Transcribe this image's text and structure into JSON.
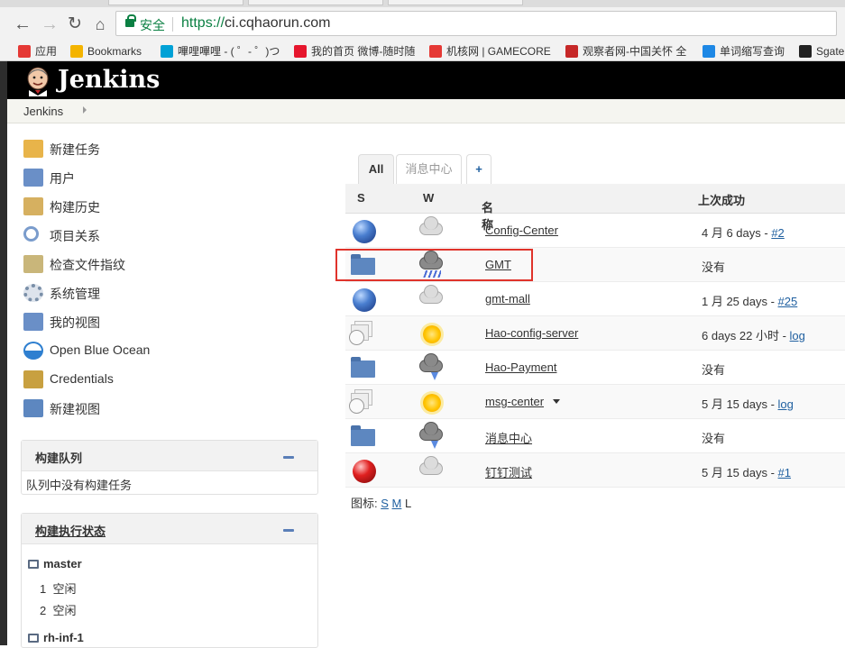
{
  "browser": {
    "secure_label": "安全",
    "url_proto": "https://",
    "url_host": "ci.cqhaorun.com"
  },
  "bookmarks": [
    {
      "label": "应用",
      "icon": "apps-grid-icon",
      "color": "#e53935"
    },
    {
      "label": "Bookmarks",
      "icon": "star-icon",
      "color": "#f4b400"
    },
    {
      "label": "嗶哩嗶哩 - ( ゜- ゜)つ",
      "icon": "bilibili-icon",
      "color": "#00a1d6"
    },
    {
      "label": "我的首页 微博-随时随",
      "icon": "weibo-icon",
      "color": "#e6162d"
    },
    {
      "label": "机核网 | GAMECORE",
      "icon": "gcores-icon",
      "color": "#e53935"
    },
    {
      "label": "观察者网-中国关怀 全",
      "icon": "guancha-icon",
      "color": "#c62828"
    },
    {
      "label": "单词缩写查询",
      "icon": "abbr-a-icon",
      "color": "#1e88e5"
    },
    {
      "label": "Sgate",
      "icon": "github-icon",
      "color": "#222222"
    }
  ],
  "header": {
    "title": "Jenkins"
  },
  "breadcrumb": {
    "root": "Jenkins"
  },
  "sidebar": {
    "tasks": [
      {
        "label": "新建任务",
        "icon": "new-item-icon"
      },
      {
        "label": "用户",
        "icon": "people-icon"
      },
      {
        "label": "构建历史",
        "icon": "build-history-icon"
      },
      {
        "label": "项目关系",
        "icon": "search-icon"
      },
      {
        "label": "检查文件指纹",
        "icon": "fingerprint-icon"
      },
      {
        "label": "系统管理",
        "icon": "gear-icon"
      },
      {
        "label": "我的视图",
        "icon": "people-icon"
      },
      {
        "label": "Open Blue Ocean",
        "icon": "blue-ocean-icon"
      },
      {
        "label": "Credentials",
        "icon": "credentials-icon"
      },
      {
        "label": "新建视图",
        "icon": "folder-icon"
      }
    ]
  },
  "queue": {
    "title": "构建队列",
    "empty_text": "队列中没有构建任务"
  },
  "executors": {
    "title": "构建执行状态",
    "nodes": [
      {
        "name": "master",
        "slots": [
          {
            "num": "1",
            "status": "空闲"
          },
          {
            "num": "2",
            "status": "空闲"
          }
        ]
      },
      {
        "name": "rh-inf-1"
      }
    ]
  },
  "view_tabs": [
    {
      "label": "All",
      "active": true
    },
    {
      "label": "消息中心",
      "active": false
    },
    {
      "label": "+",
      "active": false
    }
  ],
  "jobs_table": {
    "columns": {
      "s": "S",
      "w": "W",
      "name": "名称",
      "sort_arrow": "↓",
      "last_success": "上次成功"
    },
    "rows": [
      {
        "s": "blue-ball",
        "w": "cloudy",
        "name": "Config-Center",
        "last_text": "4 月 6 days - ",
        "last_link": "#2"
      },
      {
        "s": "folder",
        "w": "rain",
        "name": "GMT",
        "last_text": "没有",
        "last_link": ""
      },
      {
        "s": "blue-ball",
        "w": "cloudy",
        "name": "gmt-mall",
        "last_text": "1 月 25 days - ",
        "last_link": "#25"
      },
      {
        "s": "pipeline",
        "w": "sunny",
        "name": "Hao-config-server",
        "last_text": "6 days 22 小时 - ",
        "last_link": "log"
      },
      {
        "s": "folder",
        "w": "storm",
        "name": "Hao-Payment",
        "last_text": "没有",
        "last_link": ""
      },
      {
        "s": "pipeline",
        "w": "sunny",
        "name": "msg-center",
        "last_text": "5 月 15 days - ",
        "last_link": "log",
        "dropdown": true
      },
      {
        "s": "folder",
        "w": "storm",
        "name": "消息中心",
        "last_text": "没有",
        "last_link": ""
      },
      {
        "s": "red-ball",
        "w": "cloudy",
        "name": "钉钉测试",
        "last_text": "5 月 15 days - ",
        "last_link": "#1"
      }
    ]
  },
  "legend": {
    "label": "图标: ",
    "s": "S",
    "m": "M",
    "l": "L"
  },
  "colors": {
    "jenkins_header": "#000000",
    "highlight_box": "#e0332b",
    "link": "#2060a0",
    "secure_green": "#0b8043"
  }
}
